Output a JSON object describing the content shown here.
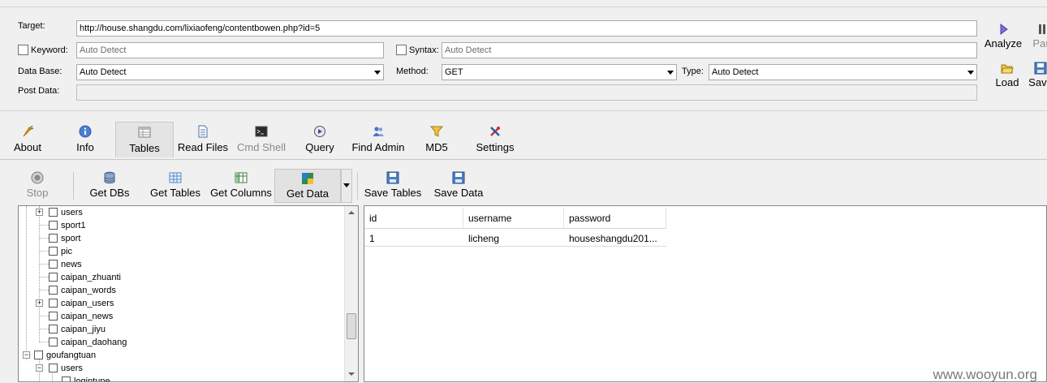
{
  "form": {
    "target_label": "Target:",
    "target_value": "http://house.shangdu.com/lixiaofeng/contentbowen.php?id=5",
    "keyword_label": "Keyword:",
    "keyword_placeholder": "Auto Detect",
    "syntax_label": "Syntax:",
    "syntax_placeholder": "Auto Detect",
    "database_label": "Data Base:",
    "database_value": "Auto Detect",
    "method_label": "Method:",
    "method_value": "GET",
    "type_label": "Type:",
    "type_value": "Auto Detect",
    "postdata_label": "Post Data:"
  },
  "right_buttons": {
    "analyze": "Analyze",
    "pause": "Pau",
    "load": "Load",
    "save": "Save"
  },
  "tabs": [
    {
      "label": "About",
      "icon": "carrot-icon"
    },
    {
      "label": "Info",
      "icon": "info-icon"
    },
    {
      "label": "Tables",
      "icon": "table-icon"
    },
    {
      "label": "Read Files",
      "icon": "document-icon"
    },
    {
      "label": "Cmd Shell",
      "icon": "terminal-icon"
    },
    {
      "label": "Query",
      "icon": "query-icon"
    },
    {
      "label": "Find Admin",
      "icon": "users-icon"
    },
    {
      "label": "MD5",
      "icon": "funnel-icon"
    },
    {
      "label": "Settings",
      "icon": "tools-icon"
    }
  ],
  "toolbar": {
    "stop": "Stop",
    "get_dbs": "Get DBs",
    "get_tables": "Get Tables",
    "get_columns": "Get Columns",
    "get_data": "Get Data",
    "save_tables": "Save Tables",
    "save_data": "Save Data"
  },
  "tree": [
    {
      "label": "users"
    },
    {
      "label": "sport1"
    },
    {
      "label": "sport"
    },
    {
      "label": "pic"
    },
    {
      "label": "news"
    },
    {
      "label": "caipan_zhuanti"
    },
    {
      "label": "caipan_words"
    },
    {
      "label": "caipan_users"
    },
    {
      "label": "caipan_news"
    },
    {
      "label": "caipan_jiyu"
    },
    {
      "label": "caipan_daohang"
    },
    {
      "label": "goufangtuan"
    },
    {
      "label": "users"
    },
    {
      "label": "logintupe"
    }
  ],
  "grid": {
    "columns": [
      "id",
      "username",
      "password"
    ],
    "rows": [
      [
        "1",
        "licheng",
        "houseshangdu201..."
      ]
    ]
  },
  "watermark": "www.wooyun.org",
  "colors": {
    "background": "#f0f0f0",
    "accent": "#1a66c2"
  }
}
